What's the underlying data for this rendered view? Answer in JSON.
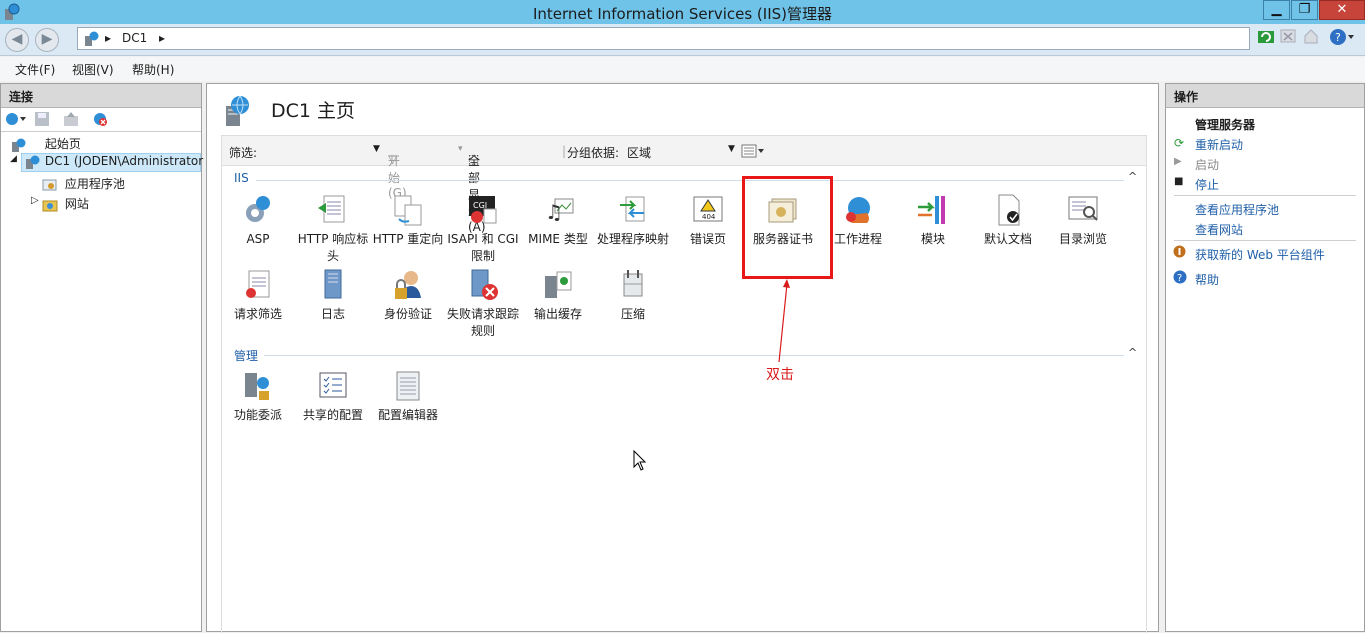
{
  "window": {
    "title": "Internet Information Services (IIS)管理器",
    "min": "▁",
    "max": "❐",
    "close": "✕"
  },
  "address": {
    "arrow1": "▸",
    "node": "DC1",
    "arrow2": "▸"
  },
  "menu": {
    "file": "文件(F)",
    "view": "视图(V)",
    "help": "帮助(H)"
  },
  "connections": {
    "header": "连接",
    "tree": {
      "start_page": "起始页",
      "server": "DC1 (JODEN\\Administrator",
      "app_pools": "应用程序池",
      "sites": "网站",
      "expand_server": "◢",
      "expand_sites": "▷"
    }
  },
  "main": {
    "title": "DC1 主页",
    "filter_label": "筛选:",
    "start_label": "开始(G)",
    "show_all_label": "全部显示(A)",
    "group_by_label": "分组依据:",
    "group_by_value": "区域",
    "sections": [
      {
        "label": "IIS",
        "features": [
          {
            "name": "ASP"
          },
          {
            "name": "HTTP 响应标头"
          },
          {
            "name": "HTTP 重定向"
          },
          {
            "name": "ISAPI 和 CGI 限制"
          },
          {
            "name": "MIME 类型"
          },
          {
            "name": "处理程序映射"
          },
          {
            "name": "错误页"
          },
          {
            "name": "服务器证书"
          },
          {
            "name": "工作进程"
          },
          {
            "name": "模块"
          },
          {
            "name": "默认文档"
          },
          {
            "name": "目录浏览"
          },
          {
            "name": "请求筛选"
          },
          {
            "name": "日志"
          },
          {
            "name": "身份验证"
          },
          {
            "name": "失败请求跟踪规则"
          },
          {
            "name": "输出缓存"
          },
          {
            "name": "压缩"
          }
        ]
      },
      {
        "label": "管理",
        "features": [
          {
            "name": "功能委派"
          },
          {
            "name": "共享的配置"
          },
          {
            "name": "配置编辑器"
          }
        ]
      }
    ],
    "annotation": "双击",
    "collapse_glyph": "^"
  },
  "actions": {
    "header": "操作",
    "group_manage_server": "管理服务器",
    "restart": "重新启动",
    "start": "启动",
    "stop": "停止",
    "view_app_pools": "查看应用程序池",
    "view_sites": "查看网站",
    "get_web_platform": "获取新的 Web 平台组件",
    "help": "帮助"
  },
  "colors": {
    "highlight": "#e81818",
    "link": "#1f5fa8",
    "titlebar": "#6fc3e8"
  }
}
